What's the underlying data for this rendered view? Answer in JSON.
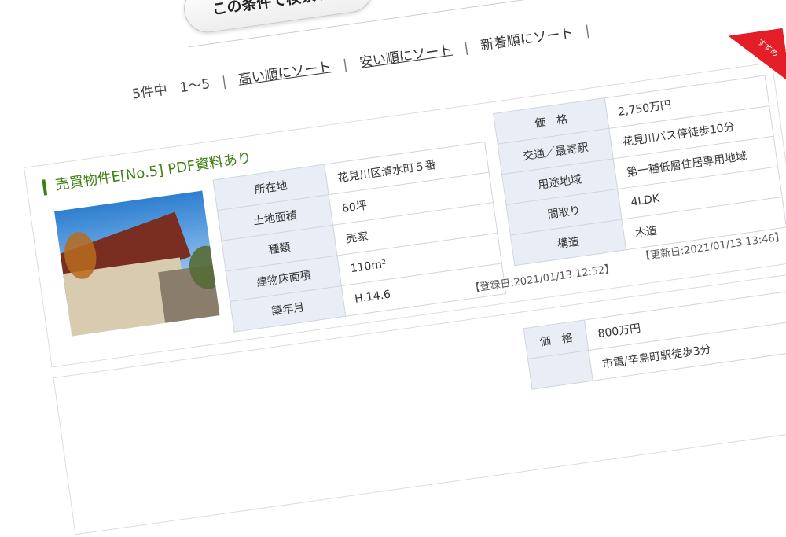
{
  "search": {
    "button_label": "この条件で検索する"
  },
  "sort": {
    "count": "5件中",
    "range": "1〜5",
    "sep": "|",
    "high": "高い順にソート",
    "low": "安い順にソート",
    "new": "新着順にソート"
  },
  "ribbon": {
    "label": "すすめ"
  },
  "listing1": {
    "title": "売買物件E[No.5] PDF資料あり",
    "left_rows": [
      {
        "label": "所在地",
        "value": "花見川区清水町５番"
      },
      {
        "label": "土地面積",
        "value": "60坪"
      },
      {
        "label": "種類",
        "value": "売家"
      },
      {
        "label": "建物床面積",
        "value": "110m²"
      },
      {
        "label": "築年月",
        "value": "H.14.6"
      }
    ],
    "right_rows": [
      {
        "label": "価　格",
        "value": "2,750万円"
      },
      {
        "label": "交通／最寄駅",
        "value": "花見川バス停徒歩10分"
      },
      {
        "label": "用途地域",
        "value": "第一種低層住居専用地域"
      },
      {
        "label": "間取り",
        "value": "4LDK"
      },
      {
        "label": "構造",
        "value": "木造"
      }
    ],
    "registered": "【登録日:2021/01/13 12:52】",
    "updated": "【更新日:2021/01/13 13:46】"
  },
  "listing2": {
    "right_rows": [
      {
        "label": "価　格",
        "value": "800万円"
      },
      {
        "label": "",
        "value": "市電/辛島町駅徒歩3分"
      }
    ]
  },
  "colors": {
    "title_green": "#3f7f12",
    "header_bg": "#e9edf6",
    "ribbon_red": "#e41e26"
  }
}
